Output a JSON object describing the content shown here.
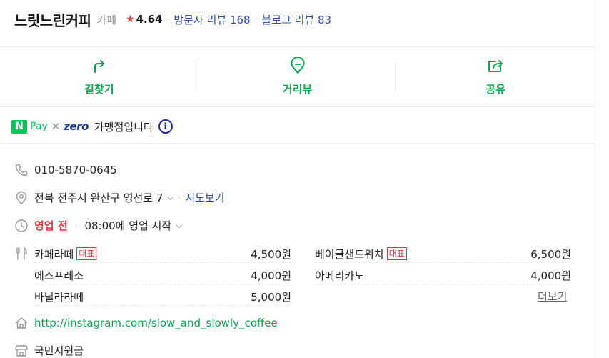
{
  "place": {
    "name": "느릿느린커피",
    "category": "카페",
    "star": "★",
    "rating": "4.64",
    "visitor_reviews": "방문자 리뷰 168",
    "blog_reviews": "블로그 리뷰 83",
    "separator": "·"
  },
  "actions": [
    {
      "label": "길찾기",
      "icon": "directions-icon"
    },
    {
      "label": "거리뷰",
      "icon": "street-view-icon"
    },
    {
      "label": "공유",
      "icon": "share-icon"
    }
  ],
  "pay": {
    "npay_badge": "N",
    "npay_word": "Pay",
    "times": "✕",
    "zero": "zero",
    "text": "가맹점입니다",
    "info": "i"
  },
  "info": {
    "phone": "010-5870-0645",
    "address": "전북 전주시 완산구 영선로 7",
    "map_link": "지도보기",
    "status": "영업 전",
    "hours": "08:00에 영업 시작",
    "chevron": "⌵",
    "website": "http://instagram.com/slow_and_slowly_coffee",
    "facility": "국민지원금"
  },
  "menu": {
    "badge": "대표",
    "items": [
      {
        "name": "카페라떼",
        "price": "4,500원",
        "signature": true
      },
      {
        "name": "베이글샌드위치",
        "price": "6,500원",
        "signature": true
      },
      {
        "name": "에스프레소",
        "price": "4,000원",
        "signature": false
      },
      {
        "name": "아메리카노",
        "price": "4,000원",
        "signature": false
      },
      {
        "name": "바닐라라떼",
        "price": "5,000원",
        "signature": false
      }
    ],
    "more": "더보기"
  },
  "colors": {
    "accent_green": "#03a94d",
    "link_blue": "#2f4ba0",
    "closed_red": "#e0353c",
    "star_red": "#ef3d43"
  }
}
